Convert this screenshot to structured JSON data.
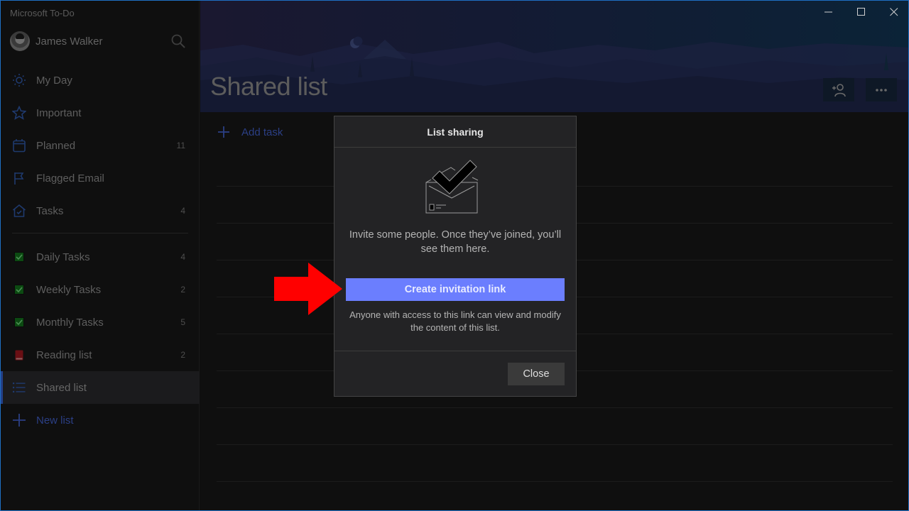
{
  "app": {
    "title": "Microsoft To-Do",
    "window_controls": [
      "minimize-icon",
      "maximize-icon",
      "close-icon"
    ]
  },
  "profile": {
    "name": "James Walker",
    "search_icon": "search-icon"
  },
  "sidebar": {
    "smart_lists": [
      {
        "label": "My Day",
        "icon": "sun-icon",
        "count": ""
      },
      {
        "label": "Important",
        "icon": "star-icon",
        "count": ""
      },
      {
        "label": "Planned",
        "icon": "calendar-icon",
        "count": "11"
      },
      {
        "label": "Flagged Email",
        "icon": "flag-icon",
        "count": ""
      },
      {
        "label": "Tasks",
        "icon": "home-icon",
        "count": "4"
      }
    ],
    "lists": [
      {
        "label": "Daily Tasks",
        "icon": "green-check-icon",
        "count": "4"
      },
      {
        "label": "Weekly Tasks",
        "icon": "green-check-icon",
        "count": "2"
      },
      {
        "label": "Monthly Tasks",
        "icon": "green-check-icon",
        "count": "5"
      },
      {
        "label": "Reading list",
        "icon": "book-icon",
        "count": "2"
      },
      {
        "label": "Shared list",
        "icon": "list-icon",
        "count": "",
        "active": true
      }
    ],
    "new_list_label": "New list"
  },
  "main": {
    "title": "Shared list",
    "share_button_icon": "add-person-icon",
    "more_button_icon": "more-icon",
    "add_task_label": "Add task"
  },
  "dialog": {
    "title": "List sharing",
    "message": "Invite some people. Once they’ve joined, you’ll see them here.",
    "primary_button": "Create invitation link",
    "note": "Anyone with access to this link can view and modify the content of this list.",
    "close_button": "Close"
  },
  "colors": {
    "accent": "#6b7efe",
    "annotation_arrow": "#ff0000",
    "sidebar_icon": "#1f3a6e",
    "window_border": "#1e6fc4"
  }
}
